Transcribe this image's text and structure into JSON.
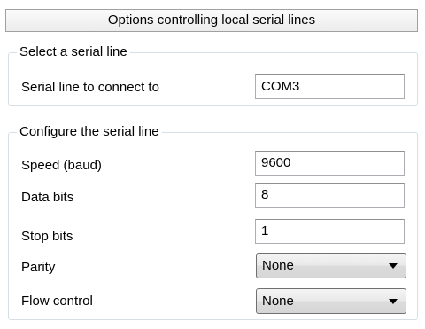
{
  "header": {
    "title": "Options controlling local serial lines"
  },
  "select_group": {
    "title": "Select a serial line",
    "serial_line": {
      "label": "Serial line to connect to",
      "value": "COM3"
    }
  },
  "config_group": {
    "title": "Configure the serial line",
    "speed": {
      "label": "Speed (baud)",
      "value": "9600"
    },
    "data_bits": {
      "label": "Data bits",
      "value": "8"
    },
    "stop_bits": {
      "label": "Stop bits",
      "value": "1"
    },
    "parity": {
      "label": "Parity",
      "selected": "None"
    },
    "flow_control": {
      "label": "Flow control",
      "selected": "None"
    }
  },
  "icons": {
    "dropdown_arrow": "chevron-down-icon"
  }
}
